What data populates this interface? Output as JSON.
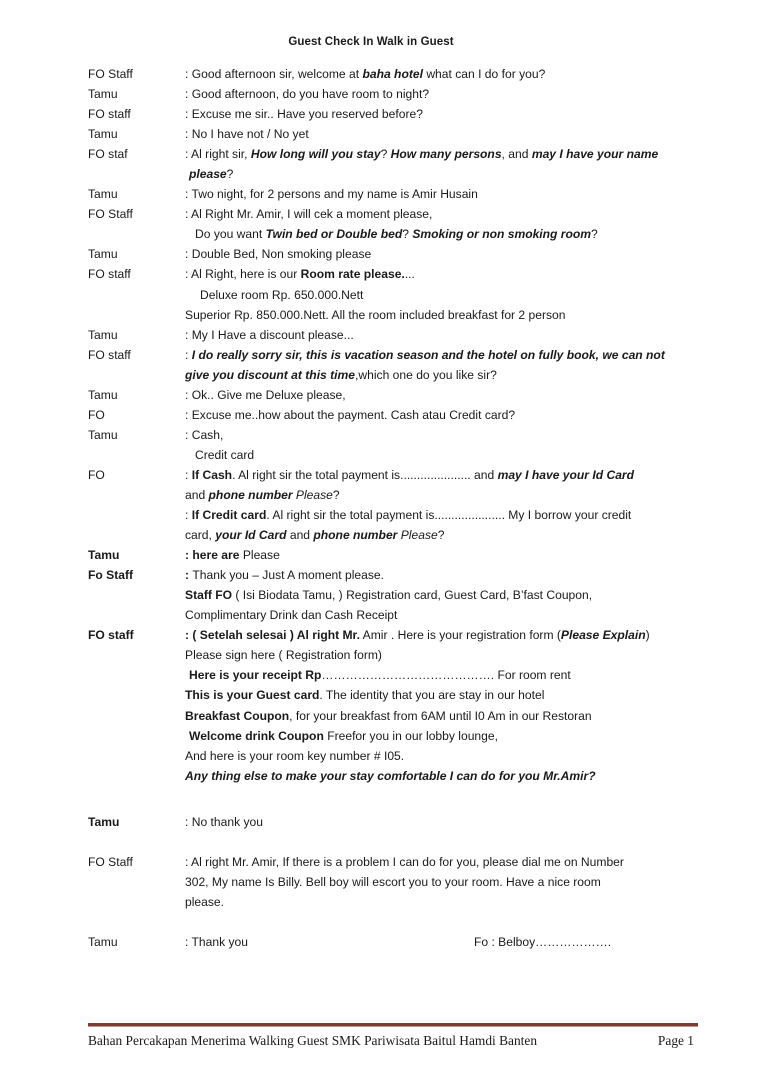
{
  "document": {
    "title": "Guest Check In Walk in Guest"
  },
  "dialogue": [
    {
      "speaker": "FO Staff",
      "lines": [
        ": Good afternoon sir, welcome at ",
        "baha hotel",
        " what can I do for you?"
      ]
    },
    {
      "speaker": "Tamu",
      "lines": [
        ": Good afternoon, do you have room to night?"
      ]
    },
    {
      "speaker": "FO staff",
      "lines": [
        ": Excuse me sir.. Have you reserved before?"
      ]
    },
    {
      "speaker": "Tamu",
      "lines": [
        ": No I have not / No yet"
      ]
    },
    {
      "speaker": "FO staf",
      "l1_a": ": Al right sir, ",
      "l1_b": "How long will you stay",
      "l1_c": "? ",
      "l1_d": "How many persons",
      "l1_e": ", and ",
      "l1_f": "may I have your name",
      "l2_a": "please",
      "l2_b": "?"
    },
    {
      "speaker": "Tamu",
      "lines": [
        ": Two night, for 2 persons and my name is  Amir Husain"
      ]
    },
    {
      "speaker": "FO Staff",
      "l1": ": Al Right Mr. Amir, I will cek a moment please,",
      "l2_a": "Do you want  ",
      "l2_b": "Twin bed or Double bed",
      "l2_c": "? ",
      "l2_d": "Smoking or non smoking room",
      "l2_e": "?"
    },
    {
      "speaker": "Tamu",
      "lines": [
        ": Double Bed, Non smoking please"
      ]
    },
    {
      "speaker": "FO staff",
      "l1_a": ": Al Right, here is our ",
      "l1_b": "Room rate please.",
      "l1_c": "...",
      "l2": "Deluxe room   Rp. 650.000.Nett",
      "l3": "Superior Rp. 850.000.Nett.  All the room included breakfast for 2 person"
    },
    {
      "speaker": "Tamu",
      "lines": [
        ": My I Have a discount please..."
      ]
    },
    {
      "speaker": "FO staff",
      "l1_a": ": ",
      "l1_b": "I do really sorry sir, this is vacation season and the hotel on fully book, we can not",
      "l2_a": "give you discount at this time",
      "l2_b": ",which one do you like sir?"
    },
    {
      "speaker": "Tamu",
      "lines": [
        ": Ok.. Give me Deluxe please,"
      ]
    },
    {
      "speaker": "FO",
      "lines": [
        ": Excuse me..how about the payment.  Cash atau Credit card?"
      ]
    },
    {
      "speaker": "Tamu",
      "l1": ":  Cash,",
      "l2": "Credit card"
    },
    {
      "speaker": "FO",
      "cash_a": ":  ",
      "cash_b": "If Cash",
      "cash_c": ". Al right sir the total payment is..................... and ",
      "cash_d": "may I have your Id Card",
      "cash_e": "and ",
      "cash_f": "phone number ",
      "cash_g": "Please",
      "cash_h": "?",
      "credit_a": ":  ",
      "credit_b": "If Credit card",
      "credit_c": ". Al right sir the total payment is..................... My I borrow your credit",
      "credit_d": "card, ",
      "credit_e": "your Id Card",
      "credit_f": " and ",
      "credit_g": "phone number ",
      "credit_h": "Please",
      "credit_i": "?"
    },
    {
      "speaker": "Tamu",
      "bold_label": true,
      "l1_a": ": here are",
      "l1_b": " Please"
    },
    {
      "speaker": "Fo Staff",
      "bold_label": true,
      "l1_a": ": ",
      "l1_b": "Thank you – Just A moment please.",
      "l2_a": "Staff FO",
      "l2_b": "  ( Isi Biodata Tamu, ) Registration card, Guest Card, B’fast Coupon,",
      "l3": "Complimentary Drink  dan Cash Receipt"
    },
    {
      "speaker": "FO staff",
      "bold_label": true,
      "r1_a": ": ( Setelah selesai ) Al right Mr.",
      "r1_b": " Amir . Here is your registration form (",
      "r1_c": "Please Explain",
      "r1_d": ")",
      "r2": "Please sign here ( Registration form)",
      "r3_a": "Here is your receipt Rp",
      "r3_b": "…………………………………….",
      "r3_c": " For room rent",
      "r4_a": "This is your Guest card",
      "r4_b": ". The identity that you are stay in our hotel",
      "r5_a": "Breakfast Coupon",
      "r5_b": ", for your breakfast from 6AM until I0 Am in our Restoran",
      "r6_a": "Welcome drink Coupon",
      "r6_b": " Freefor you in our lobby lounge,",
      "r7": "And here is your room key number # I05.",
      "r8": "Any thing else to make your stay comfortable I can do for you Mr.Amir?"
    },
    {
      "speaker": "Tamu",
      "bold_label": true,
      "l1": ": No thank you"
    },
    {
      "speaker": "FO Staff",
      "l1": ":  Al right Mr. Amir, If there is a problem I can do for you, please dial me on Number",
      "l2": "302, My name Is Billy. Bell boy will escort you to your room. Have a nice room",
      "l3": "please."
    },
    {
      "speaker": "Tamu",
      "l1": ": Thank you",
      "l2": "Fo : Belboy………………."
    }
  ],
  "footer": {
    "left": "Bahan Percakapan Menerima Walking Guest SMK Pariwisata Baitul Hamdi Banten",
    "right": "Page 1",
    "rule_color": "#7c3b33"
  }
}
